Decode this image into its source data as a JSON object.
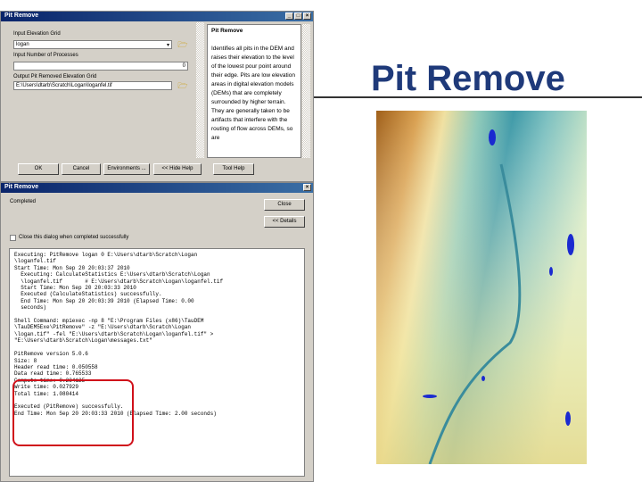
{
  "slide": {
    "title": "Pit Remove"
  },
  "tool_dialog": {
    "title": "Pit Remove",
    "input_grid_label": "Input Elevation Grid",
    "input_grid_value": "logan",
    "processes_label": "Input Number of Processes",
    "processes_value": "0",
    "output_label": "Output Pit Removed Elevation Grid",
    "output_value": "E:\\Users\\dtarb\\Scratch\\Logan\\loganfel.tif",
    "help_title": "Pit Remove",
    "help_text": "Identifies all pits in the DEM and raises their elevation to the level of the lowest pour point around their edge. Pits are low elevation areas in digital elevation models (DEMs) that are completely surrounded by higher terrain. They are generally taken to be artifacts that interfere with the routing of flow across DEMs, so are",
    "buttons": {
      "ok": "OK",
      "cancel": "Cancel",
      "env": "Environments ...",
      "hide_help": "<< Hide Help",
      "tool_help": "Tool Help"
    }
  },
  "progress_dialog": {
    "title": "Pit Remove",
    "status": "Completed",
    "close_btn": "Close",
    "details_btn": "<< Details",
    "checkbox_label": "Close this dialog when completed successfully",
    "log": [
      "Executing: PitRemove logan 0 E:\\Users\\dtarb\\Scratch\\Logan",
      "\\loganfel.tif",
      "Start Time: Mon Sep 20 20:03:37 2010",
      "  Executing: CalculateStatistics E:\\Users\\dtarb\\Scratch\\Logan",
      "  \\loganfel.tif       # E:\\Users\\dtarb\\Scratch\\Logan\\loganfel.tif",
      "  Start Time: Mon Sep 20 20:03:33 2010",
      "  Executed (CalculateStatistics) successfully.",
      "  End Time: Mon Sep 20 20:03:39 2010 (Elapsed Time: 0.00",
      "  seconds)",
      "",
      "Shell Command: mpiexec -np 8 \"E:\\Program Files (x86)\\TauDEM",
      "\\TauDEM5Exe\\PitRemove\" -z \"E:\\Users\\dtarb\\Scratch\\Logan",
      "\\logan.tif\" -fel \"E:\\Users\\dtarb\\Scratch\\Logan\\loganfel.tif\" >",
      "\"E:\\Users\\dtarb\\Scratch\\Logan\\messages.txt\"",
      "",
      "PitRemove version 5.0.6",
      "Size: 8",
      "Header read time: 0.050558",
      "Data read time: 0.765533",
      "Compute time: 0.234125",
      "Write time: 0.027929",
      "Total time: 1.080414",
      "",
      "Executed (PitRemove) successfully.",
      "End Time: Mon Sep 20 20:03:33 2010 (Elapsed Time: 2.00 seconds)"
    ]
  },
  "colors": {
    "highlight": "#d0101a",
    "title": "#1f3a7a"
  }
}
